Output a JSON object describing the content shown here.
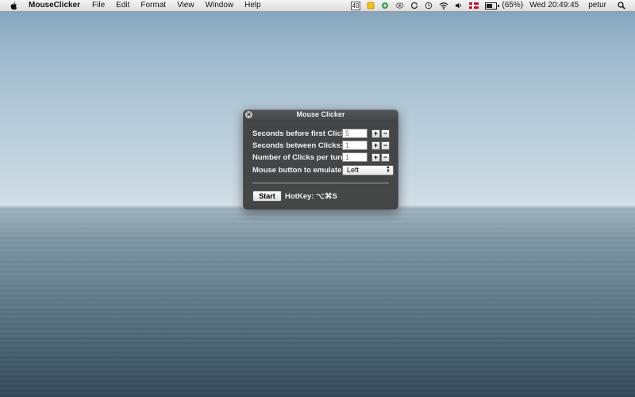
{
  "menubar": {
    "app_name": "MouseClicker",
    "items": [
      "File",
      "Edit",
      "Format",
      "View",
      "Window",
      "Help"
    ],
    "status_badge": "40",
    "battery_text": "(65%)",
    "battery_level": 0.65,
    "clock": "Wed 20:49:45",
    "user": "petur"
  },
  "window": {
    "title": "Mouse Clicker",
    "close_glyph": "✕",
    "rows": [
      {
        "label": "Seconds before first Click:",
        "value": "5"
      },
      {
        "label": "Seconds between Clicks:",
        "value": "1"
      },
      {
        "label": "Number of Clicks per turn",
        "value": "1"
      }
    ],
    "stepper_plus": "+",
    "stepper_minus": "−",
    "button_label": "Mouse button to emulate:",
    "button_value": "Left",
    "start_label": "Start",
    "hotkey_text": "HotKey: ⌥⌘S"
  }
}
